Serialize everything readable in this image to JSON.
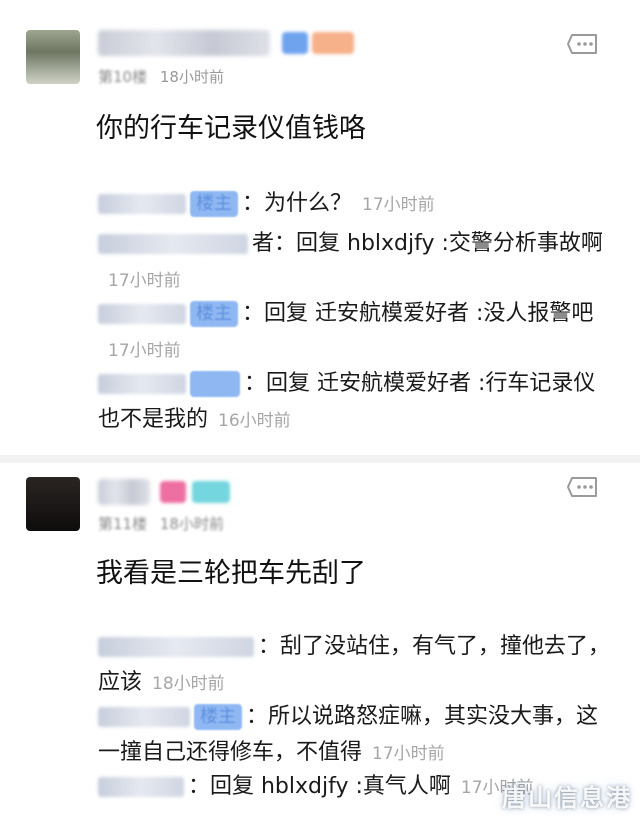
{
  "posts": [
    {
      "floor": "第10楼",
      "time": "18小时前",
      "text": "你的行车记录仪值钱咯",
      "replies": [
        {
          "badge": "楼主",
          "text": "：为什么？",
          "time": "17小时前"
        },
        {
          "badge": "者",
          "text": "：回复 hblxdjfy :交警分析事故啊",
          "time": "17小时前"
        },
        {
          "badge": "楼主",
          "text": "：回复 迁安航模爱好者 :没人报警吧",
          "time": "17小时前"
        },
        {
          "badge": "",
          "text": "：回复 迁安航模爱好者 :行车记录仪也不是我的",
          "time": "16小时前"
        }
      ]
    },
    {
      "floor": "第11楼",
      "time": "18小时前",
      "text": "我看是三轮把车先刮了",
      "replies": [
        {
          "badge": "",
          "text": "：刮了没站住，有气了，撞他去了，应该",
          "time": "18小时前"
        },
        {
          "badge": "楼主",
          "text": "：所以说路怒症嘛，其实没大事，这一撞自己还得修车，不值得",
          "time": "17小时前"
        },
        {
          "badge": "",
          "text": "：回复 hblxdjfy :真气人啊",
          "time": "17小时前"
        }
      ]
    }
  ],
  "icons": {
    "more": "comment-more-icon"
  },
  "watermark": "唐山信息港",
  "colors": {
    "time": "#a6a6a6",
    "badge_blue": "#8fb8f3",
    "badge_orange": "#f6b08a",
    "badge_pink": "#ee6fa2",
    "badge_teal": "#74d6de"
  }
}
